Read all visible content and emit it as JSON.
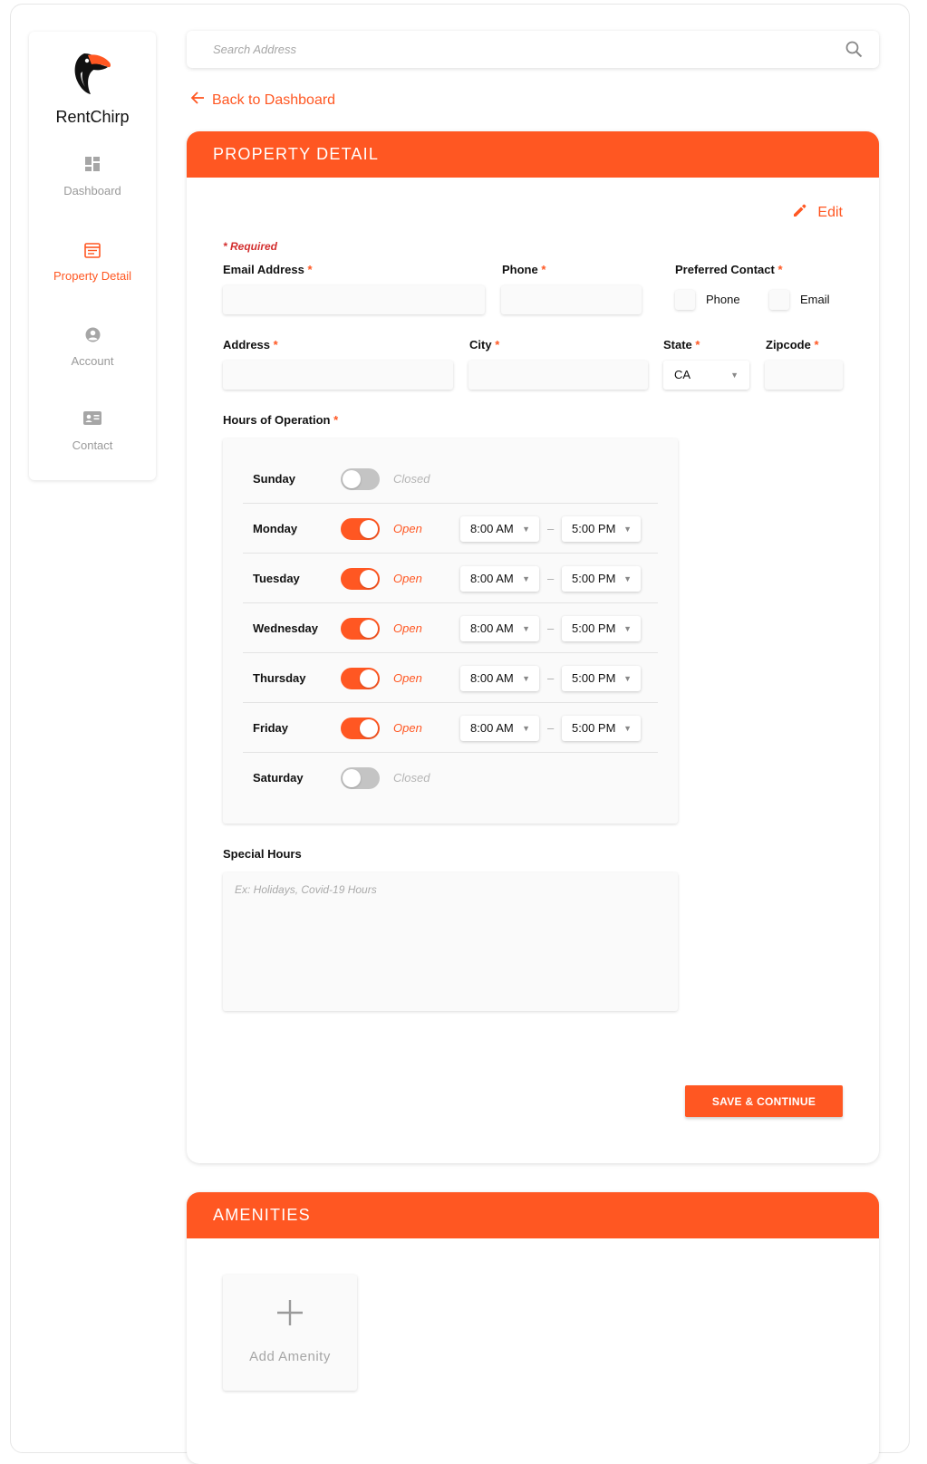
{
  "brand": {
    "name": "RentChirp",
    "logo_icon": "toucan-logo-icon"
  },
  "colors": {
    "accent": "#ff5722",
    "required": "#d32f2f",
    "muted": "#9a9a9a"
  },
  "sidebar": {
    "items": [
      {
        "label": "Dashboard",
        "icon": "dashboard-icon",
        "active": false
      },
      {
        "label": "Property Detail",
        "icon": "property-detail-icon",
        "active": true
      },
      {
        "label": "Account",
        "icon": "account-icon",
        "active": false
      },
      {
        "label": "Contact",
        "icon": "contact-card-icon",
        "active": false
      }
    ]
  },
  "search": {
    "placeholder": "Search Address",
    "value": ""
  },
  "back_link": {
    "label": "Back to Dashboard"
  },
  "property_detail": {
    "header": "PROPERTY DETAIL",
    "edit_label": "Edit",
    "required_note": "* Required",
    "fields": {
      "email": {
        "label": "Email Address",
        "value": ""
      },
      "phone": {
        "label": "Phone",
        "value": ""
      },
      "preferred_contact": {
        "label": "Preferred Contact",
        "options": [
          "Phone",
          "Email"
        ]
      },
      "address": {
        "label": "Address",
        "value": ""
      },
      "city": {
        "label": "City",
        "value": ""
      },
      "state": {
        "label": "State",
        "value": "CA"
      },
      "zipcode": {
        "label": "Zipcode",
        "value": ""
      }
    },
    "required_star": "*",
    "hours_label": "Hours of Operation",
    "hours": [
      {
        "day": "Sunday",
        "open": false,
        "status": "Closed"
      },
      {
        "day": "Monday",
        "open": true,
        "status": "Open",
        "from": "8:00 AM",
        "to": "5:00 PM"
      },
      {
        "day": "Tuesday",
        "open": true,
        "status": "Open",
        "from": "8:00 AM",
        "to": "5:00 PM"
      },
      {
        "day": "Wednesday",
        "open": true,
        "status": "Open",
        "from": "8:00 AM",
        "to": "5:00 PM"
      },
      {
        "day": "Thursday",
        "open": true,
        "status": "Open",
        "from": "8:00 AM",
        "to": "5:00 PM"
      },
      {
        "day": "Friday",
        "open": true,
        "status": "Open",
        "from": "8:00 AM",
        "to": "5:00 PM"
      },
      {
        "day": "Saturday",
        "open": false,
        "status": "Closed"
      }
    ],
    "time_separator": "–",
    "special_hours": {
      "label": "Special Hours",
      "placeholder": "Ex: Holidays, Covid-19 Hours",
      "value": ""
    },
    "save_label": "SAVE & CONTINUE"
  },
  "amenities": {
    "header": "AMENITIES",
    "add_label": "Add Amenity",
    "add_icon": "plus-icon"
  }
}
